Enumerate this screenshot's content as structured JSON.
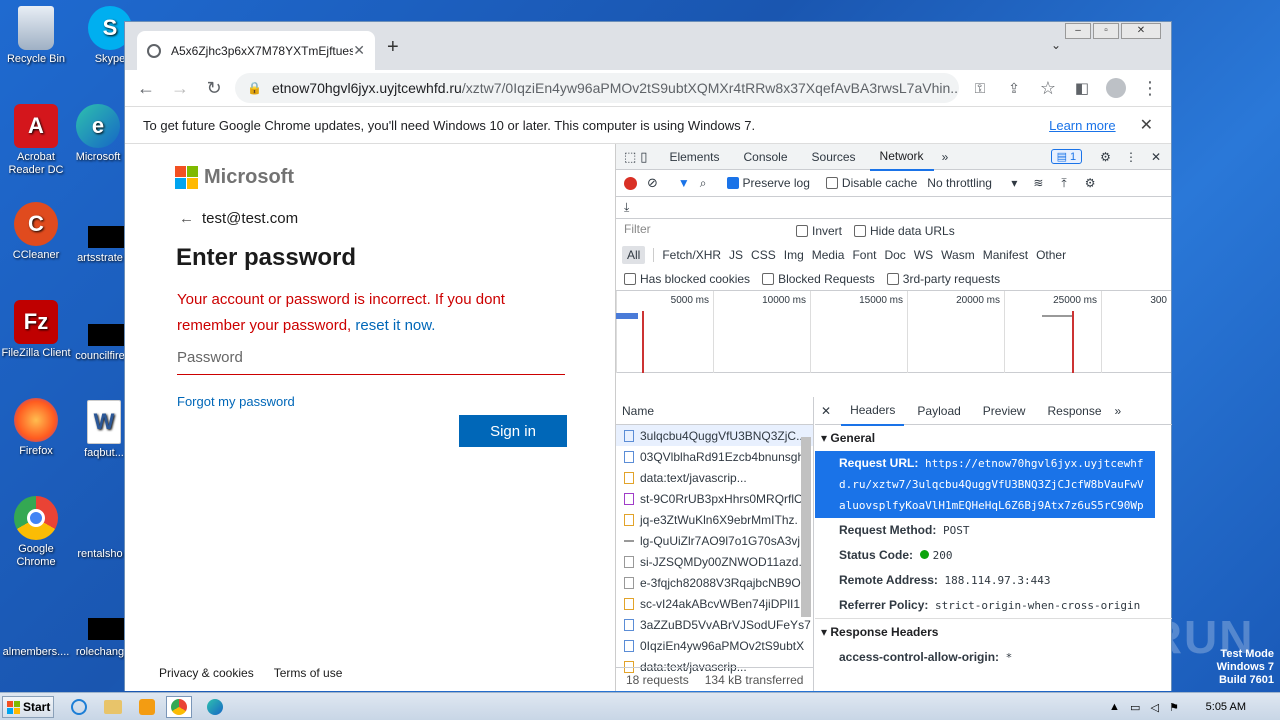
{
  "desktop": {
    "icons": [
      {
        "label": "Recycle Bin",
        "icon": "recycle-bin-icon"
      },
      {
        "label": "Skype",
        "icon": "skype-icon"
      },
      {
        "label": "Acrobat Reader DC",
        "icon": "acrobat-icon"
      },
      {
        "label": "Microsoft",
        "icon": "edge-icon"
      },
      {
        "label": "CCleaner",
        "icon": "ccleaner-icon"
      },
      {
        "label": "artsstrate",
        "icon": "file-icon"
      },
      {
        "label": "FileZilla Client",
        "icon": "filezilla-icon"
      },
      {
        "label": "councilfire",
        "icon": "file-icon"
      },
      {
        "label": "Firefox",
        "icon": "firefox-icon"
      },
      {
        "label": "faqbut...",
        "icon": "word-icon"
      },
      {
        "label": "Google Chrome",
        "icon": "chrome-icon"
      },
      {
        "label": "rentalsho",
        "icon": "file-icon"
      },
      {
        "label": "almembers....",
        "icon": "file-icon"
      },
      {
        "label": "rolechang",
        "icon": "file-icon"
      }
    ]
  },
  "browser": {
    "tab_title": "A5x6Zjhc3p6xX7M78YXTmEjftuesX",
    "address_host": "etnow70hgvl6jyx.uyjtcewhfd.ru",
    "address_path": "/xztw7/0IqziEn4yw96aPMOv2tS9ubtXQMXr4tRRw8x37XqefAvBA3rwsL7aVhin...",
    "infobar_message": "To get future Google Chrome updates, you'll need Windows 10 or later. This computer is using Windows 7.",
    "infobar_link": "Learn more"
  },
  "login": {
    "brand": "Microsoft",
    "email": "test@test.com",
    "heading": "Enter password",
    "error_text": "Your account or password is incorrect. If you dont remember your password,",
    "error_link": "reset it now.",
    "password_placeholder": "Password",
    "forgot_link": "Forgot my password",
    "signin_label": "Sign in",
    "footer_privacy": "Privacy & cookies",
    "footer_terms": "Terms of use"
  },
  "devtools": {
    "tabs": [
      "Elements",
      "Console",
      "Sources",
      "Network"
    ],
    "active_tab": "Network",
    "issues_count": "1",
    "preserve_log": "Preserve log",
    "disable_cache": "Disable cache",
    "throttling": "No throttling",
    "filter_placeholder": "Filter",
    "invert": "Invert",
    "hide_data_urls": "Hide data URLs",
    "types": [
      "All",
      "Fetch/XHR",
      "JS",
      "CSS",
      "Img",
      "Media",
      "Font",
      "Doc",
      "WS",
      "Wasm",
      "Manifest",
      "Other"
    ],
    "has_blocked_cookies": "Has blocked cookies",
    "blocked_requests": "Blocked Requests",
    "third_party": "3rd-party requests",
    "timeline_ticks": [
      "5000 ms",
      "10000 ms",
      "15000 ms",
      "20000 ms",
      "25000 ms",
      "300"
    ],
    "name_header": "Name",
    "requests": [
      "3ulqcbu4QuggVfU3BNQ3ZjC...",
      "03QVlblhaRd91Ezcb4bnunsgh",
      "data:text/javascrip...",
      "st-9C0RrUB3pxHhrs0MRQrflO",
      "jq-e3ZtWuKln6X9ebrMmIThz.",
      "lg-QuUiZlr7AO9l7o1G70sA3vj",
      "si-JZSQMDy00ZNWOD11azd.",
      "e-3fqjch82088V3RqajbcNB9O",
      "sc-vI24akABcvWBen74jiDPlI1.",
      "3aZZuBD5VvABrVJSodUFeYs7",
      "0IqziEn4yw96aPMOv2tS9ubtX",
      "data:text/javascrip..."
    ],
    "footer_requests": "18 requests",
    "footer_transferred": "134 kB transferred",
    "detail_tabs": [
      "Headers",
      "Payload",
      "Preview",
      "Response"
    ],
    "general_label": "General",
    "request_url_label": "Request URL:",
    "request_url": "https://etnow70hgvl6jyx.uyjtcewhfd.ru/xztw7/3ulqcbu4QuggVfU3BNQ3ZjCJcfW8bVauFwValuovsplfyKoaVlH1mEQHeHqL6Z6Bj9Atx7z6uS5rC90Wp",
    "request_method_label": "Request Method:",
    "request_method": "POST",
    "status_code_label": "Status Code:",
    "status_code": "200",
    "remote_address_label": "Remote Address:",
    "remote_address": "188.114.97.3:443",
    "referrer_policy_label": "Referrer Policy:",
    "referrer_policy": "strict-origin-when-cross-origin",
    "response_headers_label": "Response Headers",
    "acao_label": "access-control-allow-origin:",
    "acao_value": "*"
  },
  "taskbar": {
    "start_label": "Start",
    "clock": "5:05 AM"
  },
  "watermark": {
    "line1": "Test Mode",
    "line2": "Windows 7",
    "line3": "Build 7601",
    "brand": "ANY.RUN"
  }
}
